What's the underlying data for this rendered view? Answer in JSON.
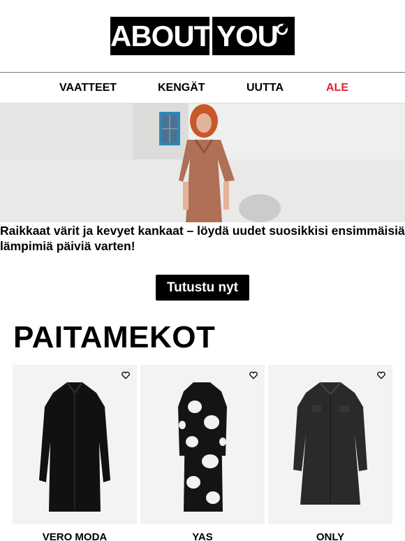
{
  "logo": {
    "left": "ABOUT",
    "right": "YOU"
  },
  "nav": {
    "items": [
      {
        "label": "VAATTEET"
      },
      {
        "label": "KENGÄT"
      },
      {
        "label": "UUTTA"
      },
      {
        "label": "ALE"
      }
    ],
    "sale_color": "#e0223a"
  },
  "hero": {
    "text": "Raikkaat värit ja kevyet kankaat – löydä uudet suosikkisi ensimmäisiä lämpimiä päiviä varten!",
    "cta_label": "Tutustu nyt"
  },
  "section": {
    "title": "PAITAMEKOT"
  },
  "products": [
    {
      "brand": "VERO MODA",
      "icon": "heart-icon"
    },
    {
      "brand": "YAS",
      "icon": "heart-icon"
    },
    {
      "brand": "ONLY",
      "icon": "heart-icon"
    }
  ]
}
